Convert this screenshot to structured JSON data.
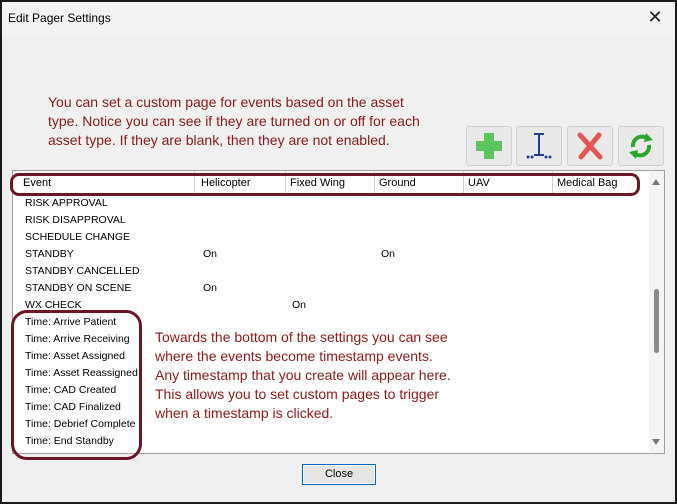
{
  "window": {
    "title": "Edit Pager Settings"
  },
  "notes": {
    "top": "You can set a custom page for events based on the asset\ntype. Notice you can see if they are turned on or off for each\nasset type. If they are blank, then they are not enabled.",
    "bottom": "Towards the bottom of the settings you can see\nwhere the events become timestamp events.\nAny timestamp that you create will appear here.\nThis allows you to set custom pages to trigger\nwhen a timestamp is clicked."
  },
  "toolbar": [
    "add-icon",
    "insert-icon",
    "delete-icon",
    "refresh-icon"
  ],
  "colors": {
    "note": "#8b1a1a",
    "highlight": "#6b1626",
    "add": "#5cc45c",
    "delete": "#e55353",
    "refresh": "#2aa72a",
    "insert": "#1f3f8f"
  },
  "grid": {
    "columns": [
      "Event",
      "Helicopter",
      "Fixed Wing",
      "Ground",
      "UAV",
      "Medical Bag"
    ],
    "rows": [
      [
        "RISK APPROVAL",
        "",
        "",
        "",
        "",
        ""
      ],
      [
        "RISK DISAPPROVAL",
        "",
        "",
        "",
        "",
        ""
      ],
      [
        "SCHEDULE CHANGE",
        "",
        "",
        "",
        "",
        ""
      ],
      [
        "STANDBY",
        "On",
        "",
        "On",
        "",
        ""
      ],
      [
        "STANDBY CANCELLED",
        "",
        "",
        "",
        "",
        ""
      ],
      [
        "STANDBY ON SCENE",
        "On",
        "",
        "",
        "",
        ""
      ],
      [
        "WX CHECK",
        "",
        "On",
        "",
        "",
        ""
      ],
      [
        "Time: Arrive Patient",
        "",
        "",
        "",
        "",
        ""
      ],
      [
        "Time: Arrive Receiving",
        "",
        "",
        "",
        "",
        ""
      ],
      [
        "Time: Asset Assigned",
        "",
        "",
        "",
        "",
        ""
      ],
      [
        "Time: Asset Reassigned",
        "",
        "",
        "",
        "",
        ""
      ],
      [
        "Time: CAD Created",
        "",
        "",
        "",
        "",
        ""
      ],
      [
        "Time: CAD Finalized",
        "",
        "",
        "",
        "",
        ""
      ],
      [
        "Time: Debrief Complete",
        "",
        "",
        "",
        "",
        ""
      ],
      [
        "Time: End Standby",
        "",
        "",
        "",
        "",
        ""
      ]
    ]
  },
  "buttons": {
    "close": "Close"
  }
}
